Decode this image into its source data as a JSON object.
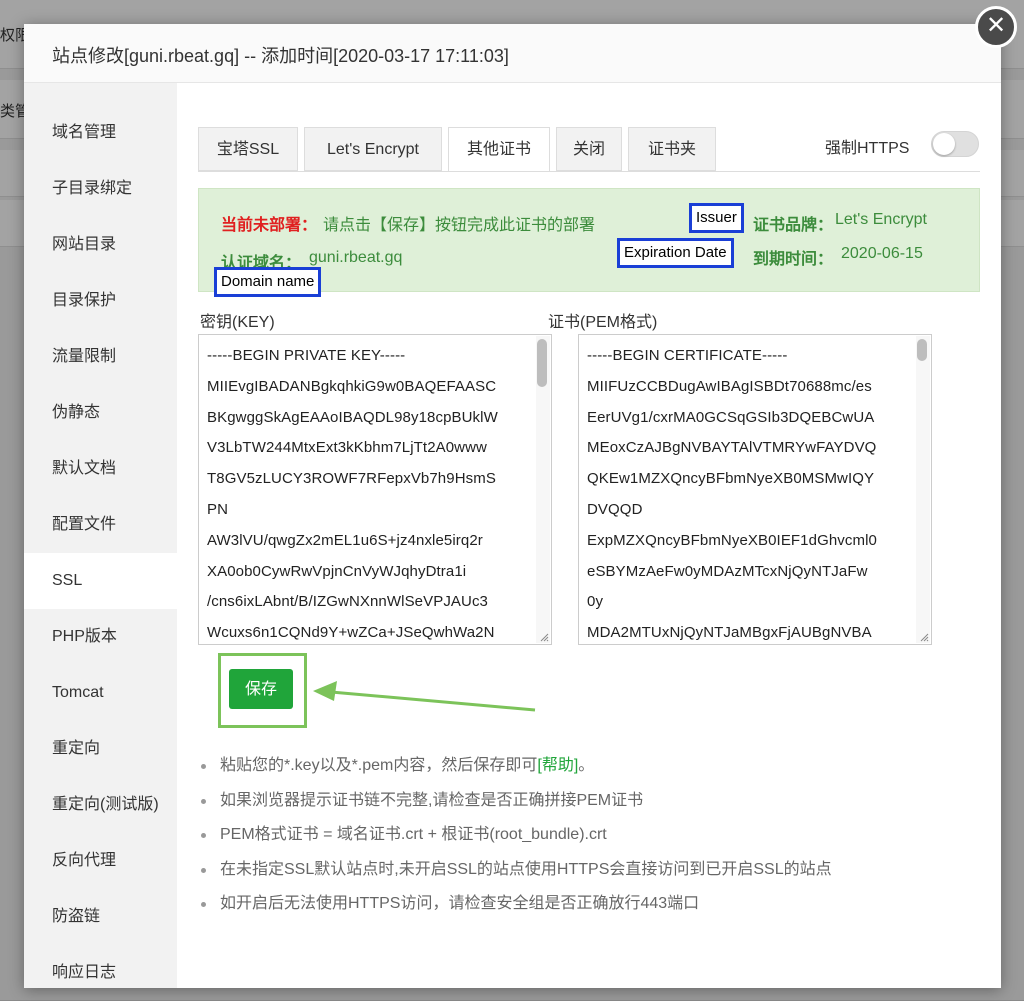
{
  "background": {
    "left_text_1": "权限",
    "left_text_2": "类管"
  },
  "dialog": {
    "title": "站点修改[guni.rbeat.gq] -- 添加时间[2020-03-17 17:11:03]",
    "close_symbol": "✕"
  },
  "sidebar": {
    "items": [
      {
        "label": "域名管理"
      },
      {
        "label": "子目录绑定"
      },
      {
        "label": "网站目录"
      },
      {
        "label": "目录保护"
      },
      {
        "label": "流量限制"
      },
      {
        "label": "伪静态"
      },
      {
        "label": "默认文档"
      },
      {
        "label": "配置文件"
      },
      {
        "label": "SSL",
        "active": true
      },
      {
        "label": "PHP版本"
      },
      {
        "label": "Tomcat"
      },
      {
        "label": "重定向"
      },
      {
        "label": "重定向(测试版)"
      },
      {
        "label": "反向代理"
      },
      {
        "label": "防盗链"
      },
      {
        "label": "响应日志"
      }
    ]
  },
  "tabs": [
    {
      "label": "宝塔SSL"
    },
    {
      "label": "Let's Encrypt"
    },
    {
      "label": "其他证书",
      "active": true
    },
    {
      "label": "关闭"
    },
    {
      "label": "证书夹"
    }
  ],
  "force_https": {
    "label": "强制HTTPS",
    "enabled": false
  },
  "status": {
    "not_deployed_label": "当前未部署：",
    "not_deployed_msg": "请点击【保存】按钮完成此证书的部署",
    "brand_label": "证书品牌：",
    "brand_value": "Let's Encrypt",
    "domain_label": "认证域名：",
    "domain_value": "guni.rbeat.gq",
    "expire_label": "到期时间：",
    "expire_value": "2020-06-15"
  },
  "annotations": {
    "issuer": "Issuer",
    "expiration": "Expiration Date",
    "domain": "Domain name"
  },
  "key_field": {
    "label": "密钥(KEY)",
    "lines": [
      "-----BEGIN PRIVATE KEY-----",
      "MIIEvgIBADANBgkqhkiG9w0BAQEFAASC",
      "BKgwggSkAgEAAoIBAQDL98y18cpBUklW",
      "V3LbTW244MtxExt3kKbhm7LjTt2A0www",
      "T8GV5zLUCY3ROWF7RFepxVb7h9HsmS",
      "PN",
      "AW3lVU/qwgZx2mEL1u6S+jz4nxle5irq2r",
      "XA0ob0CywRwVpjnCnVyWJqhyDtra1i",
      "/cns6ixLAbnt/B/IZGwNXnnWlSeVPJAUc3",
      "Wcuxs6n1CQNd9Y+wZCa+JSeQwhWa2N"
    ]
  },
  "cert_field": {
    "label": "证书(PEM格式)",
    "lines": [
      "-----BEGIN CERTIFICATE-----",
      "MIIFUzCCBDugAwIBAgISBDt70688mc/es",
      "EerUVg1/cxrMA0GCSqGSIb3DQEBCwUA",
      "MEoxCzAJBgNVBAYTAlVTMRYwFAYDVQ",
      "QKEw1MZXQncyBFbmNyeXB0MSMwIQY",
      "DVQQD",
      "ExpMZXQncyBFbmNyeXB0IEF1dGhvcml0",
      "eSBYMzAeFw0yMDAzMTcxNjQyNTJaFw",
      "0y",
      "MDA2MTUxNjQyNTJaMBgxFjAUBgNVBA"
    ]
  },
  "save_button": {
    "label": "保存"
  },
  "tips": {
    "tip1_prefix": "粘贴您的*.key以及*.pem内容，然后保存即可",
    "tip1_link": "[帮助]",
    "tip1_suffix": "。",
    "tip2": "如果浏览器提示证书链不完整,请检查是否正确拼接PEM证书",
    "tip3": "PEM格式证书 = 域名证书.crt + 根证书(root_bundle).crt",
    "tip4": "在未指定SSL默认站点时,未开启SSL的站点使用HTTPS会直接访问到已开启SSL的站点",
    "tip5": "如开启后无法使用HTTPS访问，请检查安全组是否正确放行443端口"
  },
  "colors": {
    "accent_green": "#20a53a",
    "status_bg": "#dff0d8",
    "annotation_blue": "#1a3fd6",
    "highlight_green": "#7cc35a"
  }
}
